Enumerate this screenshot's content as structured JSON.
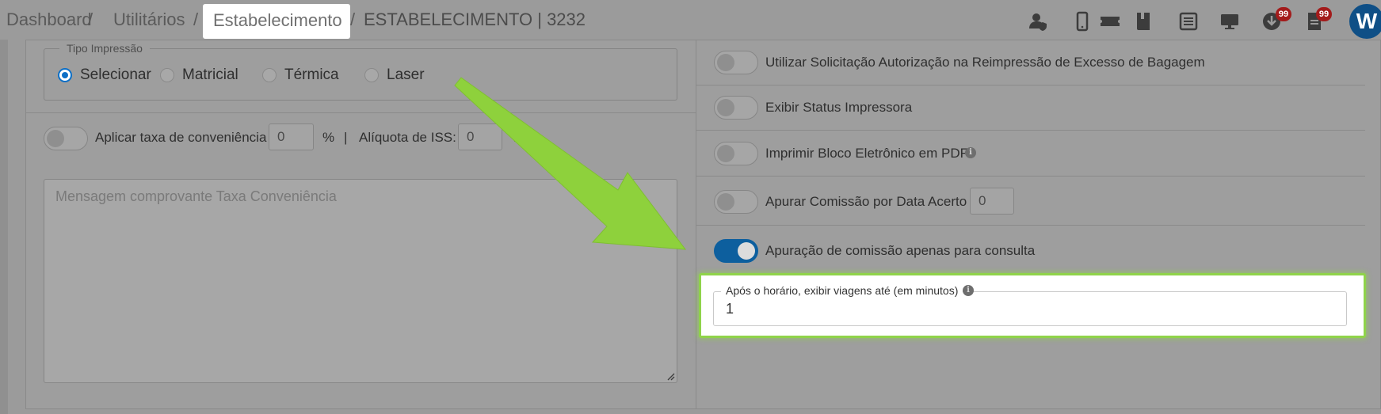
{
  "breadcrumb": {
    "items": [
      "Dashboard",
      "Utilitários",
      "Estabelecimento",
      "ESTABELECIMENTO | 3232"
    ],
    "separator": "/"
  },
  "header_icons": {
    "names": [
      "user-shield-icon",
      "mobile-icon",
      "ticket-icon",
      "book-icon",
      "list-icon",
      "monitor-icon",
      "download-icon",
      "document-icon"
    ],
    "download_badge": "99",
    "document_badge": "99",
    "avatar_letter": "W"
  },
  "print_type": {
    "legend": "Tipo Impressão",
    "options": [
      "Selecionar",
      "Matricial",
      "Térmica",
      "Laser"
    ],
    "selected": "Selecionar"
  },
  "convenience": {
    "toggle_label": "Aplicar taxa de conveniência",
    "fee_value": "0",
    "percent": "%",
    "divider": "|",
    "iss_label": "Alíquota de ISS:",
    "iss_value": "0",
    "iss_percent": "%",
    "message_placeholder": "Mensagem comprovante Taxa Conveniência"
  },
  "settings": {
    "reprint_label": "Utilizar Solicitação Autorização na Reimpressão de Excesso de Bagagem",
    "printer_status_label": "Exibir Status Impressora",
    "pdf_block_label": "Imprimir Bloco Eletrônico em PDF",
    "commission_date_label": "Apurar Comissão por Data Acerto",
    "commission_date_value": "0",
    "commission_query_label": "Apuração de comissão apenas para consulta",
    "commission_query_on": true
  },
  "highlight_field": {
    "label": "Após o horário, exibir viagens até (em minutos)",
    "value": "1"
  },
  "colors": {
    "accent": "#0d6fc6",
    "highlight": "#8fd34a",
    "badge": "#a31b1b",
    "avatar": "#0f4f86"
  }
}
